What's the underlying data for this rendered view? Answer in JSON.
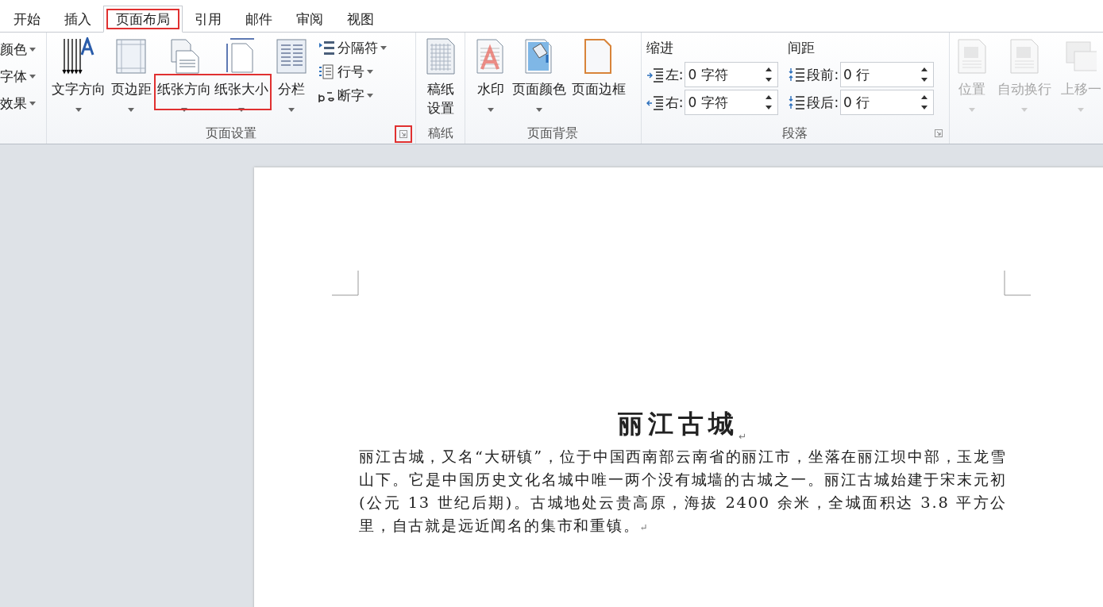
{
  "tabs": [
    {
      "label": "开始",
      "selected": false,
      "highlighted": false
    },
    {
      "label": "插入",
      "selected": false,
      "highlighted": false
    },
    {
      "label": "页面布局",
      "selected": true,
      "highlighted": true
    },
    {
      "label": "引用",
      "selected": false,
      "highlighted": false
    },
    {
      "label": "邮件",
      "selected": false,
      "highlighted": false
    },
    {
      "label": "审阅",
      "selected": false,
      "highlighted": false
    },
    {
      "label": "视图",
      "selected": false,
      "highlighted": false
    }
  ],
  "theme_group": {
    "items": [
      {
        "label": "颜色"
      },
      {
        "label": "字体"
      },
      {
        "label": "效果"
      }
    ]
  },
  "page_setup_group": {
    "label": "页面设置",
    "launcher_highlighted": true,
    "large_buttons": [
      {
        "label": "文字方向",
        "dropdown": true,
        "highlighted": false
      },
      {
        "label": "页边距",
        "dropdown": true,
        "highlighted": false
      },
      {
        "label": "纸张方向",
        "dropdown": true,
        "highlighted": true
      },
      {
        "label": "纸张大小",
        "dropdown": true,
        "highlighted": true
      },
      {
        "label": "分栏",
        "dropdown": true,
        "highlighted": false
      }
    ],
    "small_buttons": [
      {
        "label": "分隔符"
      },
      {
        "label": "行号"
      },
      {
        "label": "断字"
      }
    ]
  },
  "manuscript_group": {
    "label": "稿纸",
    "button": {
      "label": "稿纸设置"
    }
  },
  "background_group": {
    "label": "页面背景",
    "buttons": [
      {
        "label": "水印",
        "dropdown": true
      },
      {
        "label": "页面颜色",
        "dropdown": true
      },
      {
        "label": "页面边框",
        "dropdown": false
      }
    ]
  },
  "paragraph_group": {
    "label": "段落",
    "indent": {
      "heading": "缩进",
      "fields": [
        {
          "label": "左:",
          "value": "0 字符"
        },
        {
          "label": "右:",
          "value": "0 字符"
        }
      ]
    },
    "spacing": {
      "heading": "间距",
      "fields": [
        {
          "label": "段前:",
          "value": "0 行"
        },
        {
          "label": "段后:",
          "value": "0 行"
        }
      ]
    }
  },
  "arrange_group": {
    "buttons": [
      {
        "label": "位置",
        "disabled": true
      },
      {
        "label": "自动换行",
        "disabled": true
      },
      {
        "label": "上移一",
        "disabled": true
      }
    ]
  },
  "document": {
    "title": "丽江古城",
    "title_mark": "↵",
    "paragraph": "丽江古城，又名“大研镇”，位于中国西南部云南省的丽江市，坐落在丽江坝中部，玉龙雪山下。它是中国历史文化名城中唯一两个没有城墙的古城之一。丽江古城始建于宋末元初(公元 13 世纪后期)。古城地处云贵高原，海拔 2400 余米，全城面积达 3.8 平方公里，自古就是远近闻名的集市和重镇。",
    "paragraph_mark": "↵"
  }
}
